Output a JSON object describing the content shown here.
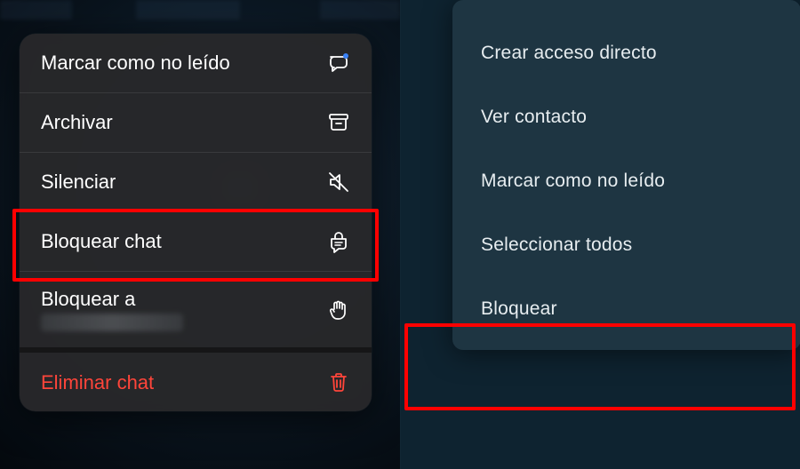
{
  "ios_menu": {
    "items": [
      {
        "label": "Marcar como no leído",
        "icon": "unread-icon"
      },
      {
        "label": "Archivar",
        "icon": "archive-icon"
      },
      {
        "label": "Silenciar",
        "icon": "mute-icon"
      },
      {
        "label": "Bloquear chat",
        "icon": "lock-chat-icon",
        "highlighted": true
      },
      {
        "label": "Bloquear a",
        "icon": "block-hand-icon",
        "has_redacted_sub": true
      },
      {
        "label": "Eliminar chat",
        "icon": "trash-icon",
        "destructive": true
      }
    ]
  },
  "android_menu": {
    "items": [
      {
        "label": "Crear acceso directo"
      },
      {
        "label": "Ver contacto"
      },
      {
        "label": "Marcar como no leído"
      },
      {
        "label": "Seleccionar todos"
      },
      {
        "label": "Bloquear",
        "highlighted": true
      }
    ]
  },
  "colors": {
    "ios_menu_bg": "#28282a",
    "android_menu_bg": "#1e3542",
    "destructive": "#ff453a",
    "highlight_border": "#ff0000"
  }
}
